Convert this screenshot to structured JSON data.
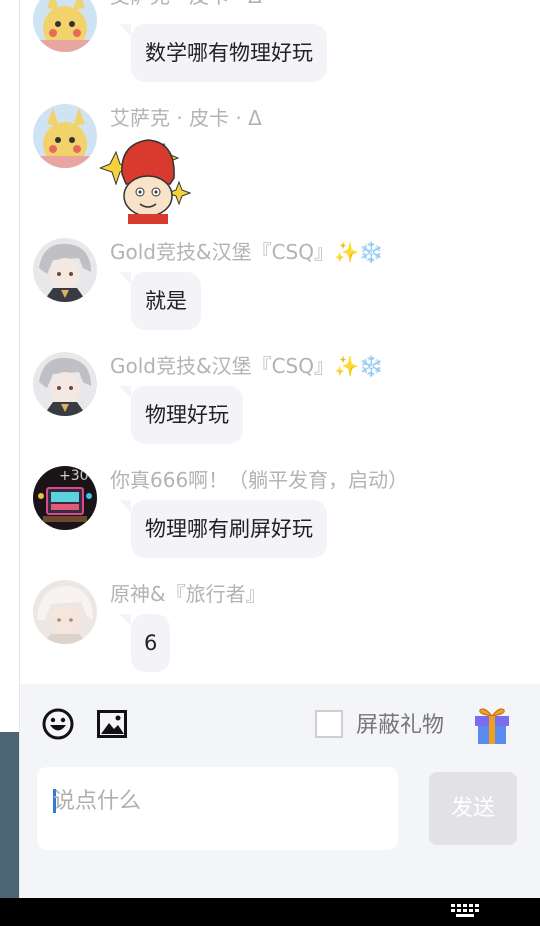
{
  "messages": [
    {
      "name": "艾萨克 · 皮卡 · Δ",
      "text": "数学哪有物理好玩"
    },
    {
      "name": "艾萨克 · 皮卡 · Δ",
      "sticker": "red-hair-sparkle-sticker"
    },
    {
      "name": "Gold竞技&汉堡『CSQ』✨❄️",
      "text": "就是"
    },
    {
      "name": "Gold竞技&汉堡『CSQ』✨❄️",
      "text": "物理好玩"
    },
    {
      "name": "你真666啊！（躺平发育，启动）",
      "text": "物理哪有刷屏好玩",
      "avatar_badge": "+30"
    },
    {
      "name": "原神&『旅行者』",
      "text": "6"
    }
  ],
  "toolbar": {
    "block_gift_label": "屏蔽礼物",
    "block_gift_checked": false,
    "emoji_icon": "emoji-icon",
    "image_icon": "image-icon",
    "gift_icon": "gift-icon"
  },
  "composer": {
    "placeholder": "说点什么",
    "send_label": "发送"
  },
  "colors": {
    "name_gray": "#b3b3b3",
    "bubble_bg": "#f4f4f8",
    "panel_bg": "#f4f5f9",
    "send_disabled": "#e2e2e6"
  }
}
